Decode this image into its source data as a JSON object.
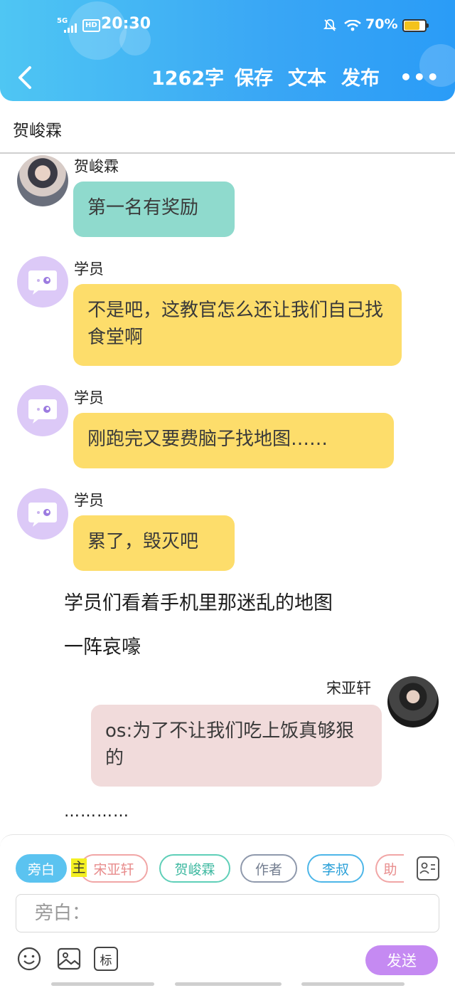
{
  "status_bar": {
    "network": "5G",
    "hd": "HD",
    "time": "20:30",
    "battery": "70%",
    "battery_level": 0.7
  },
  "header": {
    "back_icon": "chevron-left-icon",
    "word_count": "1262字",
    "save": "保存",
    "text": "文本",
    "publish": "发布",
    "more": "•••"
  },
  "subtitle": "贺峻霖",
  "messages": [
    {
      "speaker": "贺峻霖",
      "text": "第一名有奖励"
    },
    {
      "speaker": "学员",
      "text": "不是吧，这教官怎么还让我们自己找食堂啊"
    },
    {
      "speaker": "学员",
      "text": "刚跑完又要费脑子找地图……"
    },
    {
      "speaker": "学员",
      "text": "累了，毁灭吧"
    }
  ],
  "narration": {
    "line1": "学员们看着手机里那迷乱的地图",
    "line2": "一阵哀嚎"
  },
  "right_message": {
    "speaker": "宋亚轩",
    "text": "os:为了不让我们吃上饭真够狠的"
  },
  "ellipsis": "…………",
  "role_chips": [
    "旁白",
    "宋亚轩",
    "贺峻霖",
    "作者",
    "李叔",
    "助"
  ],
  "main_tag": "主",
  "input": {
    "placeholder": "旁白："
  },
  "toolbar": {
    "mark": "标",
    "send": "发送"
  },
  "colors": {
    "header": "#39a6f5",
    "teal_bubble": "#8fdacd",
    "yellow_bubble": "#fddd6b",
    "pink_bubble": "#f1dbdb",
    "send": "#c58af2"
  }
}
